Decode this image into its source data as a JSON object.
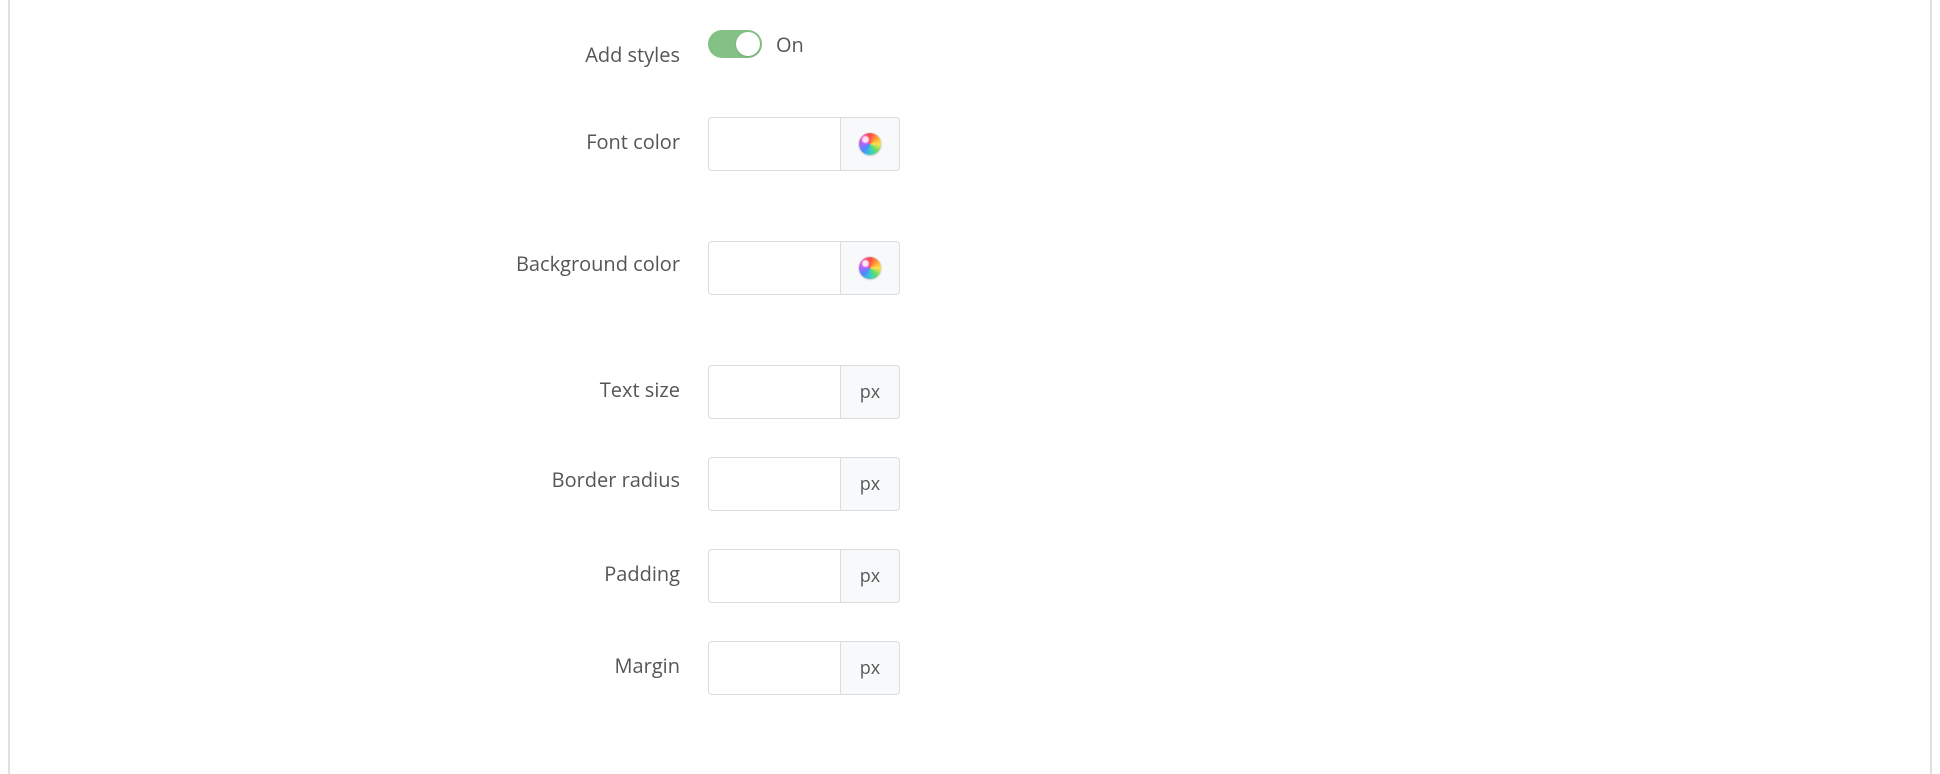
{
  "toggle": {
    "label": "Add styles",
    "state_text": "On",
    "on": true
  },
  "fields": {
    "font_color": {
      "label": "Font color",
      "value": "",
      "addon_type": "color"
    },
    "background_color": {
      "label": "Background color",
      "value": "",
      "addon_type": "color"
    },
    "text_size": {
      "label": "Text size",
      "value": "",
      "unit": "px"
    },
    "border_radius": {
      "label": "Border radius",
      "value": "",
      "unit": "px"
    },
    "padding": {
      "label": "Padding",
      "value": "",
      "unit": "px"
    },
    "margin": {
      "label": "Margin",
      "value": "",
      "unit": "px"
    }
  }
}
